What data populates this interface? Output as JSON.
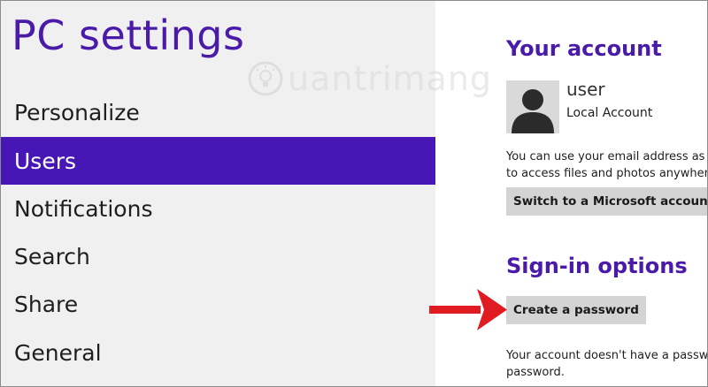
{
  "app": {
    "title": "PC settings",
    "nav": [
      {
        "label": "Personalize",
        "selected": false
      },
      {
        "label": "Users",
        "selected": true
      },
      {
        "label": "Notifications",
        "selected": false
      },
      {
        "label": "Search",
        "selected": false
      },
      {
        "label": "Share",
        "selected": false
      },
      {
        "label": "General",
        "selected": false
      }
    ]
  },
  "account": {
    "section_title": "Your account",
    "user_name": "user",
    "account_type": "Local Account",
    "description_line1": "You can use your email address as a",
    "description_line2": "to access files and photos anywhere",
    "switch_button": "Switch to a Microsoft account"
  },
  "signin": {
    "section_title": "Sign-in options",
    "create_password_button": "Create a password",
    "note_line1": "Your account doesn't have a passwo",
    "note_line2": "password."
  },
  "watermark": {
    "text": "uantrimang",
    "icon": "lightbulb-icon"
  },
  "colors": {
    "accent": "#4617b4",
    "title": "#4a1aa8",
    "left_background": "#f0f0f0",
    "button_background": "#d4d4d4",
    "arrow": "#e11b22"
  }
}
